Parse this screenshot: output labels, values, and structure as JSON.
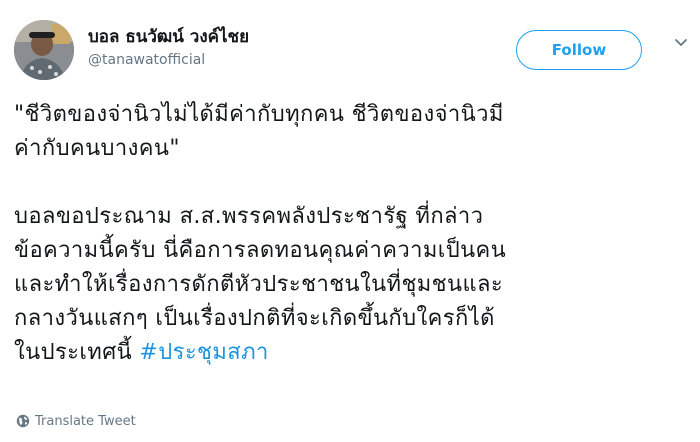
{
  "user": {
    "display_name": "บอล ธนวัฒน์ วงค์ไชย",
    "handle": "@tanawatofficial"
  },
  "follow_button": {
    "label": "Follow"
  },
  "tweet": {
    "lines": [
      "\"ชีวิตของจ่านิวไม่ได้มีค่ากับทุกคน ชีวิตของจ่านิวมี",
      "ค่ากับคนบางคน\"",
      "บอลขอประณาม ส.ส.พรรคพลังประชารัฐ ที่กล่าว",
      "ข้อความนี้ครับ นี่คือการลดทอนคุณค่าความเป็นคน",
      "และทำให้เรื่องการดักตีหัวประชาชนในที่ชุมชนและ",
      "กลางวันแสกๆ เป็นเรื่องปกติที่จะเกิดขึ้นกับใครก็ได้"
    ],
    "last_line_prefix": "ในประเทศนี้ ",
    "hashtag": "#ประชุมสภา"
  },
  "translate": {
    "label": "Translate Tweet",
    "icon": "globe-icon"
  },
  "colors": {
    "accent": "#1da1f2",
    "hashtag": "#1b95e0",
    "secondary_text": "#657786",
    "primary_text": "#14171a"
  }
}
